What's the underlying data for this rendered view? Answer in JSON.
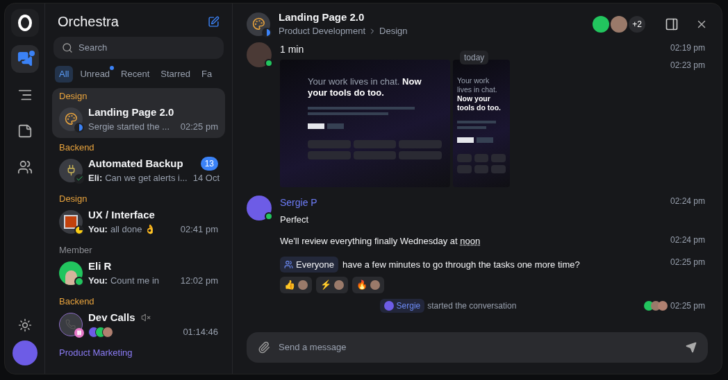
{
  "rail": {
    "items": [
      {
        "kind": "chats",
        "selected": true,
        "unread": true
      },
      {
        "kind": "tasks",
        "selected": false,
        "unread": false
      },
      {
        "kind": "notes",
        "selected": false,
        "unread": false
      },
      {
        "kind": "people",
        "selected": false,
        "unread": false
      }
    ]
  },
  "sidebar": {
    "title": "Orchestra",
    "search": {
      "placeholder": "Search"
    },
    "filters": [
      {
        "label": "All",
        "selected": true,
        "unread": false
      },
      {
        "label": "Unread",
        "selected": false,
        "unread": true
      },
      {
        "label": "Recent",
        "selected": false,
        "unread": false
      },
      {
        "label": "Starred",
        "selected": false,
        "unread": false
      },
      {
        "label": "Fa",
        "selected": false,
        "unread": false
      }
    ],
    "chats": [
      {
        "kind": "palette",
        "category": "Design",
        "color": "#e8a33d",
        "name": "Landing Page 2.0",
        "preview": "Sergie started the ...",
        "time": "02:25 pm",
        "selected": true,
        "muted": false
      },
      {
        "kind": "plug",
        "category": "Backend",
        "color": "#e8a33d",
        "name": "Automated Backup",
        "sender": "Eli:",
        "preview": "Can we get alerts i...",
        "time": "14 Oct",
        "selected": false,
        "badge": "13",
        "muted": false
      },
      {
        "kind": "image",
        "category": "Design",
        "color": "#e8a33d",
        "name": "UX / Interface",
        "sender": "You:",
        "preview": "all done 👌",
        "time": "02:41 pm",
        "selected": false,
        "muted": false
      },
      {
        "kind": "person",
        "category": "Member",
        "color": "#8b8d93",
        "name": "Eli R",
        "sender": "You:",
        "preview": "Count me in",
        "time": "12:02 pm",
        "selected": false,
        "muted": false
      },
      {
        "kind": "call",
        "category": "Backend",
        "color": "#e8a33d",
        "name": "Dev Calls",
        "time": "01:14:46",
        "selected": false,
        "muted": true
      },
      {
        "kind": "heading",
        "category": "Product Marketing",
        "color": "#8b7cf6",
        "selected": false
      }
    ]
  },
  "chat": {
    "title": "Landing Page 2.0",
    "breadcrumb": [
      "Product Development",
      "Design"
    ],
    "extra_members": "+2",
    "groups": [
      {
        "author": "1 min",
        "color": "#f3f4f6",
        "time": "02:19 pm",
        "items": [
          {
            "kind": "images",
            "time": "02:23 pm",
            "images": [
              {
                "muted": "Your work lives in chat.",
                "headline": "Now your tools do too."
              },
              {
                "muted": "Your work lives in chat.",
                "headline": "Now your tools do too."
              }
            ]
          }
        ]
      },
      {
        "author": "Sergie P",
        "color": "#6d7cf7",
        "time": "02:24 pm",
        "items": [
          {
            "kind": "text",
            "text": "Perfect"
          },
          {
            "kind": "text",
            "text": "We'll review everything finally Wednesday at ",
            "highlight": "noon",
            "time": "02:24 pm"
          },
          {
            "kind": "mention",
            "mention": "Everyone",
            "text": "have a few minutes to go through the tasks one more time?",
            "time": "02:25 pm",
            "reactions": [
              "👍",
              "⚡",
              "🔥"
            ]
          }
        ]
      }
    ],
    "divider": "today",
    "event": {
      "actor": "Sergie",
      "text": "started the conversation",
      "time": "02:25 pm"
    },
    "composer": {
      "placeholder": "Send a message"
    }
  }
}
